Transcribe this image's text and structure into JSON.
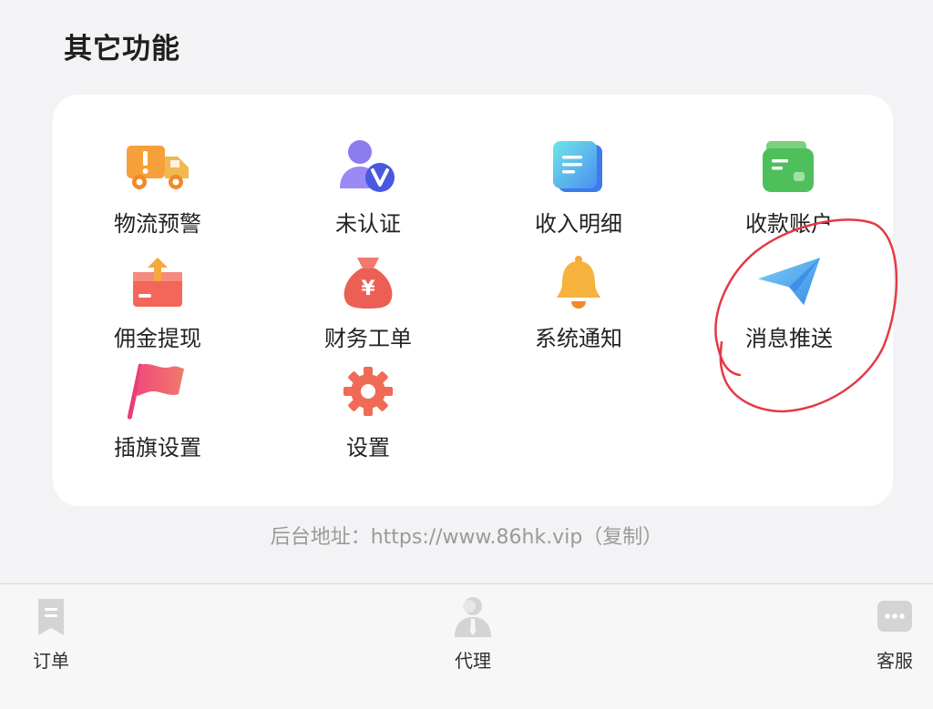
{
  "section": {
    "title": "其它功能"
  },
  "grid": {
    "items": [
      {
        "label": "物流预警",
        "icon": "truck-warning-icon"
      },
      {
        "label": "未认证",
        "icon": "user-verify-icon"
      },
      {
        "label": "收入明细",
        "icon": "document-icon"
      },
      {
        "label": "收款账户",
        "icon": "wallet-icon"
      },
      {
        "label": "佣金提现",
        "icon": "withdraw-box-icon"
      },
      {
        "label": "财务工单",
        "icon": "money-bag-icon"
      },
      {
        "label": "系统通知",
        "icon": "bell-icon"
      },
      {
        "label": "消息推送",
        "icon": "paper-plane-icon"
      },
      {
        "label": "插旗设置",
        "icon": "flag-icon"
      },
      {
        "label": "设置",
        "icon": "gear-icon"
      }
    ]
  },
  "footer": {
    "url_text": "后台地址：https://www.86hk.vip（复制）"
  },
  "tabbar": {
    "items": [
      {
        "label": "订单",
        "icon": "order-icon"
      },
      {
        "label": "代理",
        "icon": "agent-icon"
      },
      {
        "label": "客服",
        "icon": "chat-icon"
      }
    ]
  },
  "colors": {
    "background": "#f3f3f5",
    "card": "#ffffff",
    "annotation": "#e53945"
  }
}
